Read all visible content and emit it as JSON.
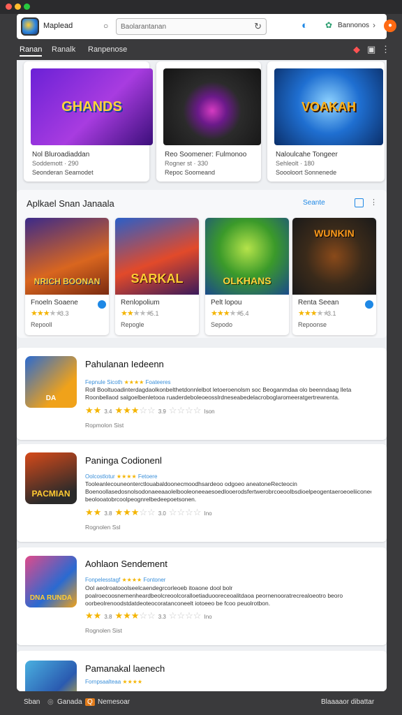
{
  "topbar": {
    "brand": "Maplead",
    "search_placeholder": "Baolarantanan",
    "account_label": "Bannonos"
  },
  "nav": {
    "tabs": [
      "Ranan",
      "Ranalk",
      "Ranpenose"
    ]
  },
  "featured": [
    {
      "art": "GHANDS",
      "title": "Nol Bluroadiaddan",
      "meta": "Soddemott · 290",
      "sub": "Seonderan Seamodet"
    },
    {
      "art": "",
      "title": "Reo Soomener: Fulmonoo",
      "meta": "Rogner st · 330",
      "sub": "Repoc Soomeand"
    },
    {
      "art": "VOAKAH",
      "title": "Naloulcahe Tongeer",
      "meta": "Sehleolt · 180",
      "sub": "Soooloort Sonnenede"
    }
  ],
  "recommended": {
    "title": "Aplkael Snan Janaala",
    "more_label": "Seante",
    "items": [
      {
        "art": "NRICH BOONAN",
        "title": "Fnoeln Soaene",
        "rating": "3.3",
        "stars": 3,
        "sub": "Repooll"
      },
      {
        "art": "SARKAL",
        "title": "Renlopolium",
        "rating": "5.1",
        "stars": 2,
        "sub": "Repogle"
      },
      {
        "art": "OLKHANS",
        "title": "Pelt lopou",
        "rating": "5.4",
        "stars": 3,
        "sub": "Sepodo"
      },
      {
        "art": "WUNKIN",
        "title": "Renta Seean",
        "rating": "3.1",
        "stars": 3,
        "sub": "Repoonse"
      }
    ]
  },
  "list": [
    {
      "title": "Pahulanan Iedeenn",
      "meta_left": "Fepnule Sicoth",
      "meta_right": "Foateeres",
      "desc": "Roll Booltuoadinterdagdaolkonbelthetdonnlelbot letoeroenolsm soc Beoganmdaa olo beenndaag lleta Roonbellaod salgoelbenletooa ruaderdeboleoeosslrdneseabedelacroboglaromeeratgertrewrenta.",
      "rating_small": "3.4",
      "rating_mid": "3.9",
      "rating_end": "Ison",
      "foot": "Ropmolon Sist",
      "art": "DA"
    },
    {
      "title": "Paninga Codionenl",
      "meta_left": "Oolcostlotur",
      "meta_right": "Fetoere",
      "desc": "Tooleanlecouneonterctlouabaldoonecmoodhsardeoo odgoeo aneatoneRecteocin Boenoollasedosnolsodonaeeaaolelbooleoneeaesoedlooerodsfertwerobrcoeoolbsdioelpeogentaeroeoeliiconeentcoanottnnoaloat beolooatobrcoolpeognrelbedeepoetsonen.",
      "rating_small": "3.8",
      "rating_mid": "3.0",
      "rating_end": "Ino",
      "foot": "Rognolen Ssl",
      "art": "PACMIAN"
    },
    {
      "title": "Aohlaon Sendement",
      "meta_left": "Fonpelesstagf",
      "meta_right": "Fontoner",
      "desc": "Ool aeolroatooolseelcaendegrcorleoeb itoaone dool bolr poalroecoosnemenheardbeolcreoolcoralloetiaduooreceoalitdaoa peornenooratrecrealoeotro beoro oorbeolrenoodstdatdeoteocoratanconeelt iotoeeo be fcoo peuolrotbon.",
      "rating_small": "3.8",
      "rating_mid": "3.3",
      "rating_end": "Ino",
      "foot": "Rognolen Sist",
      "art": "DNA RUNDA"
    },
    {
      "title": "Pamanakal laenech",
      "meta_left": "Fornpsaalteaa",
      "meta_right": "",
      "desc": "",
      "rating_small": "",
      "rating_mid": "",
      "rating_end": "",
      "foot": "",
      "art": ""
    }
  ],
  "footer": {
    "left": "Sban",
    "mid": "Ganada",
    "mid2": "Nemesoar",
    "right": "Blaaaaor dibattar"
  },
  "colors": {
    "accent": "#1e88e5",
    "star": "#f4b400",
    "dark": "#3a3a3c"
  }
}
